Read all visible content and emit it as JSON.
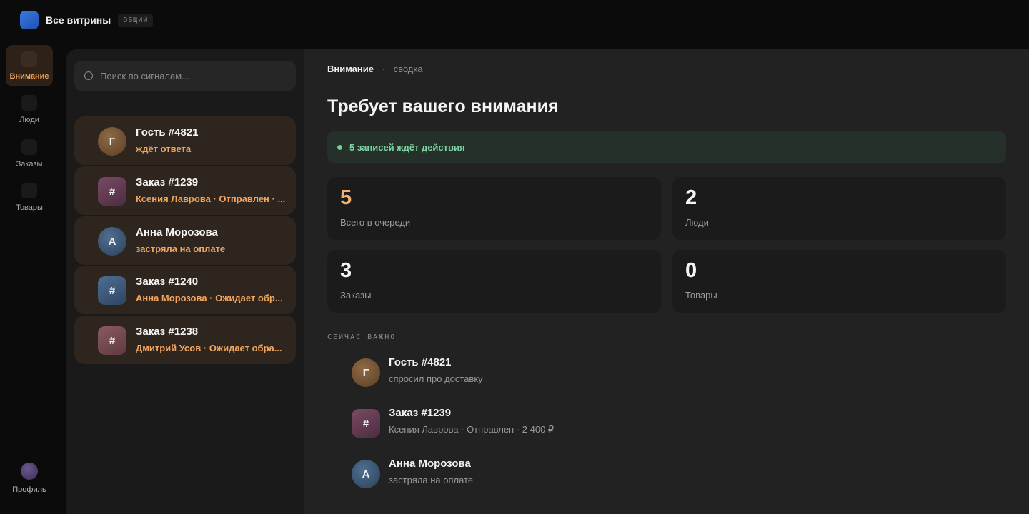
{
  "header": {
    "title": "Все витрины",
    "badge": "ОБЩИЙ"
  },
  "rail": {
    "items": [
      {
        "label": "Внимание",
        "active": true
      },
      {
        "label": "Люди",
        "active": false
      },
      {
        "label": "Заказы",
        "active": false
      },
      {
        "label": "Товары",
        "active": false
      }
    ],
    "profile_label": "Профиль"
  },
  "search": {
    "placeholder": "Поиск по сигналам..."
  },
  "signals": [
    {
      "avatar": "Г",
      "title": "Гость #4821",
      "subtitle": "ждёт ответа"
    },
    {
      "avatar": "#",
      "title": "Заказ #1239",
      "subtitle": "Ксения Лаврова · Отправлен · ..."
    },
    {
      "avatar": "А",
      "title": "Анна Морозова",
      "subtitle": "застряла на оплате"
    },
    {
      "avatar": "#",
      "title": "Заказ #1240",
      "subtitle": "Анна Морозова · Ожидает обр..."
    },
    {
      "avatar": "#",
      "title": "Заказ #1238",
      "subtitle": "Дмитрий Усов · Ожидает обра..."
    }
  ],
  "main": {
    "breadcrumb": {
      "current": "Внимание",
      "separator": "·",
      "parent": "сводка"
    },
    "title": "Требует вашего внимания",
    "alert": "5 записей ждёт действия",
    "stats": [
      {
        "value": "5",
        "label": "Всего в очереди"
      },
      {
        "value": "2",
        "label": "Люди"
      },
      {
        "value": "3",
        "label": "Заказы"
      },
      {
        "value": "0",
        "label": "Товары"
      }
    ],
    "section_label": "СЕЙЧАС ВАЖНО",
    "important": [
      {
        "avatar": "Г",
        "title": "Гость #4821",
        "subtitle": "спросил про доставку"
      },
      {
        "avatar": "#",
        "title": "Заказ #1239",
        "subtitle": "Ксения Лаврова · Отправлен · 2 400 ₽"
      },
      {
        "avatar": "А",
        "title": "Анна Морозова",
        "subtitle": "застряла на оплате"
      }
    ]
  },
  "colors": {
    "accent": "#f0a560",
    "success": "#7fd3a2",
    "background": "#0b0b0b",
    "panel": "#222222"
  }
}
